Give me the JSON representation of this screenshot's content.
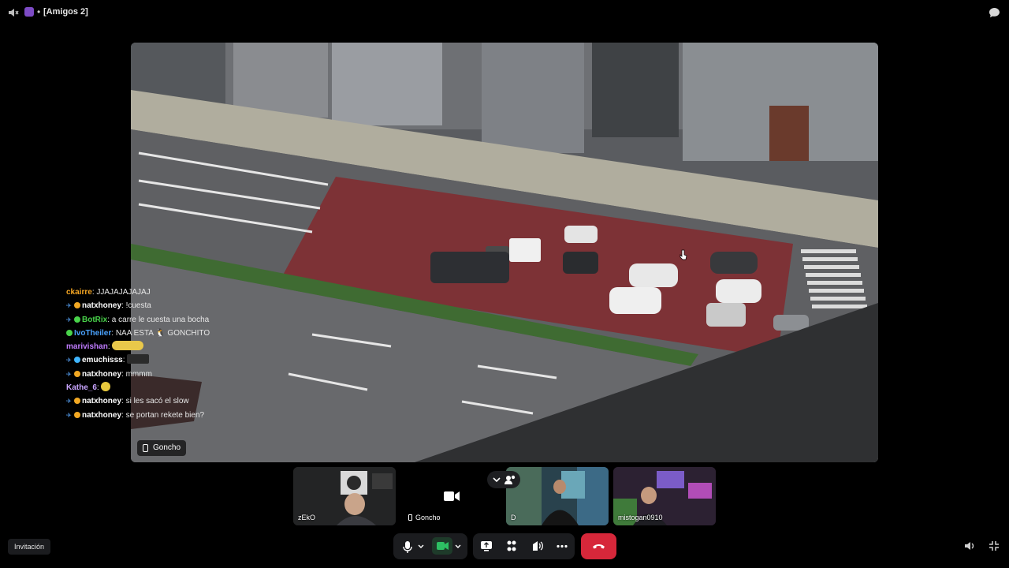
{
  "header": {
    "separator": "•",
    "title": "[Amigos 2]",
    "icons": [
      "speaker-muted-icon",
      "server-icon",
      "chat-bubble-icon"
    ]
  },
  "stage": {
    "streamer": "Goncho",
    "device_icon": "mobile-phone-icon"
  },
  "chat": [
    {
      "user": "ckairre",
      "color": "#f5a623",
      "badges": [],
      "message": "JJAJAJAJAJAJ",
      "emote": null
    },
    {
      "user": "natxhoney",
      "color": "#ffffff",
      "badges": [
        "pin",
        "gold"
      ],
      "message": "!cuesta",
      "emote": null
    },
    {
      "user": "BotRix",
      "color": "#49d34a",
      "badges": [
        "pin",
        "green"
      ],
      "message": "a carre le cuesta una bocha",
      "emote": null
    },
    {
      "user": "IvoTheiler",
      "color": "#4aa3ff",
      "badges": [
        "green"
      ],
      "message": "NAA ESTA 🐧 GONCHITO",
      "emote": null
    },
    {
      "user": "marivishan",
      "color": "#c07cff",
      "badges": [],
      "message": "",
      "emote": "emote-yellow"
    },
    {
      "user": "emuchisss",
      "color": "#ffffff",
      "badges": [
        "pin",
        "blue"
      ],
      "message": "",
      "emote": "emote-dark"
    },
    {
      "user": "natxhoney",
      "color": "#ffffff",
      "badges": [
        "pin",
        "gold"
      ],
      "message": "mmmm",
      "emote": null
    },
    {
      "user": "Kathe_6",
      "color": "#c9a5ff",
      "badges": [],
      "message": "",
      "emote": "emote-small"
    },
    {
      "user": "natxhoney",
      "color": "#ffffff",
      "badges": [
        "pin",
        "gold"
      ],
      "message": "si les sacó el slow",
      "emote": null
    },
    {
      "user": "natxhoney",
      "color": "#ffffff",
      "badges": [
        "pin",
        "gold"
      ],
      "message": "se portan rekete bien?",
      "emote": null
    }
  ],
  "participants": [
    {
      "name": "zEkO",
      "device": null
    },
    {
      "name": "Goncho",
      "device": "mobile-phone-icon"
    },
    {
      "name": "D",
      "device": null
    },
    {
      "name": "mistogan0910",
      "device": null
    }
  ],
  "footer": {
    "invite_label": "Invitación",
    "controls": [
      "microphone-icon",
      "chevron-down-icon",
      "camera-icon",
      "chevron-down-icon",
      "screen-share-icon",
      "activities-icon",
      "soundboard-icon",
      "more-icon",
      "hang-up-icon"
    ],
    "right_icons": [
      "volume-icon",
      "fullscreen-exit-icon"
    ]
  },
  "colors": {
    "leave": "#d6273a",
    "camera_on": "#2dbf63",
    "bike_lane": "#7d3236"
  }
}
